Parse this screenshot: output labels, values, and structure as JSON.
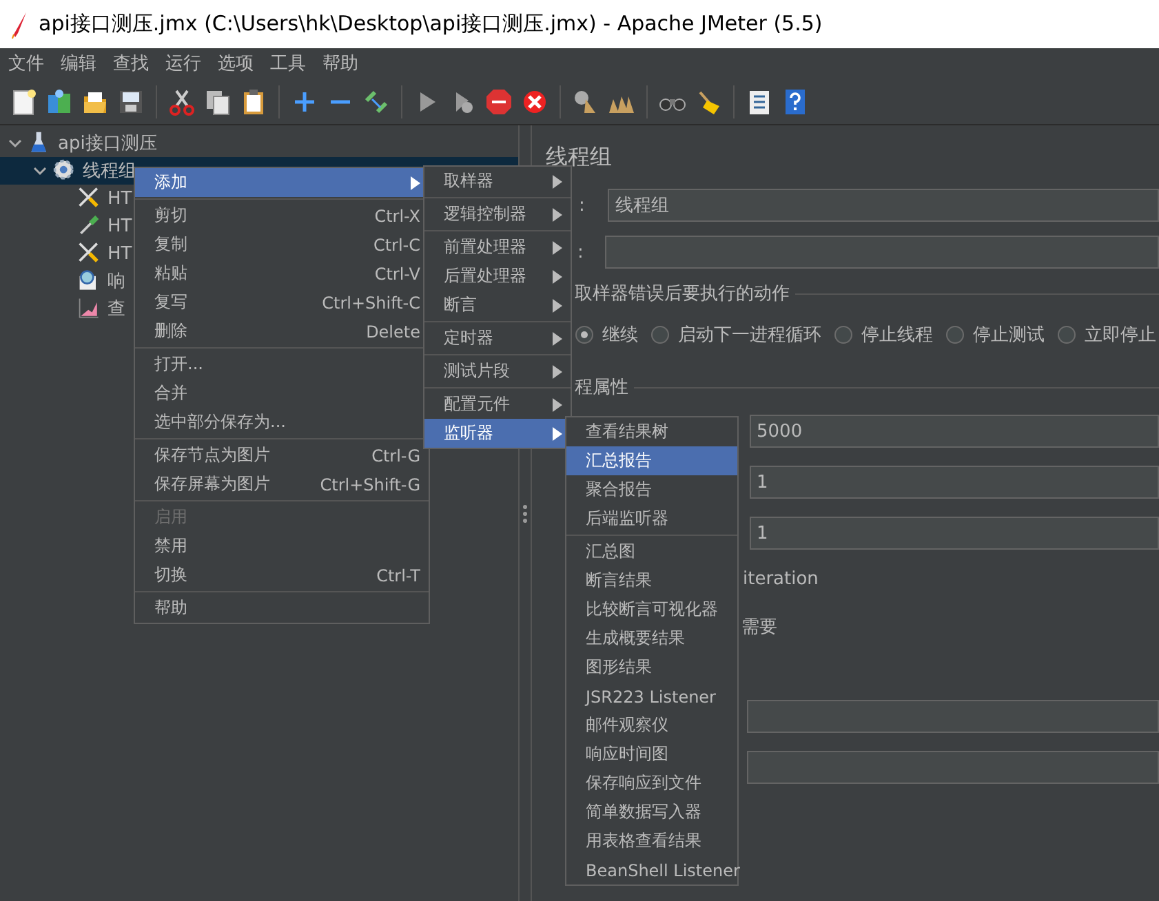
{
  "window": {
    "title": "api接口测压.jmx (C:\\Users\\hk\\Desktop\\api接口测压.jmx) - Apache JMeter (5.5)"
  },
  "menu_bar": [
    "文件",
    "编辑",
    "查找",
    "运行",
    "选项",
    "工具",
    "帮助"
  ],
  "tree": [
    {
      "label": "api接口测压",
      "expanded": true,
      "selected": false,
      "children": [
        {
          "label": "线程组",
          "expanded": true,
          "selected": true,
          "children": [
            {
              "label": "HT",
              "selected": false
            },
            {
              "label": "HT",
              "selected": false
            },
            {
              "label": "HT",
              "selected": false
            },
            {
              "label": "响",
              "selected": false
            },
            {
              "label": "查",
              "selected": false
            }
          ]
        }
      ]
    }
  ],
  "panel": {
    "title": "线程组",
    "name_label": ":",
    "name_value": "线程组",
    "comment_label": ":",
    "error_action": {
      "title": "取样器错误后要执行的动作",
      "options": [
        {
          "label": "继续",
          "selected": true
        },
        {
          "label": "启动下一进程循环",
          "selected": false
        },
        {
          "label": "停止线程",
          "selected": false
        },
        {
          "label": "停止测试",
          "selected": false
        },
        {
          "label": "立即停止",
          "selected": false
        }
      ]
    },
    "properties": {
      "title": "程属性",
      "fields": [
        "5000",
        "1",
        "1"
      ],
      "iteration_text": "iteration",
      "needs_text": "需要"
    }
  },
  "context_menu": {
    "groups": [
      [
        {
          "label": "添加",
          "submenu": true,
          "selected": true,
          "disabled": false
        }
      ],
      [
        {
          "label": "剪切",
          "shortcut": "Ctrl-X",
          "submenu": false,
          "selected": false,
          "disabled": false
        },
        {
          "label": "复制",
          "shortcut": "Ctrl-C",
          "submenu": false,
          "selected": false,
          "disabled": false
        },
        {
          "label": "粘贴",
          "shortcut": "Ctrl-V",
          "submenu": false,
          "selected": false,
          "disabled": false
        },
        {
          "label": "复写",
          "shortcut": "Ctrl+Shift-C",
          "submenu": false,
          "selected": false,
          "disabled": false
        },
        {
          "label": "删除",
          "shortcut": "Delete",
          "submenu": false,
          "selected": false,
          "disabled": false
        }
      ],
      [
        {
          "label": "打开...",
          "submenu": false,
          "selected": false,
          "disabled": false
        },
        {
          "label": "合并",
          "submenu": false,
          "selected": false,
          "disabled": false
        },
        {
          "label": "选中部分保存为...",
          "submenu": false,
          "selected": false,
          "disabled": false
        }
      ],
      [
        {
          "label": "保存节点为图片",
          "shortcut": "Ctrl-G",
          "submenu": false,
          "selected": false,
          "disabled": false
        },
        {
          "label": "保存屏幕为图片",
          "shortcut": "Ctrl+Shift-G",
          "submenu": false,
          "selected": false,
          "disabled": false
        }
      ],
      [
        {
          "label": "启用",
          "submenu": false,
          "selected": false,
          "disabled": true
        },
        {
          "label": "禁用",
          "submenu": false,
          "selected": false,
          "disabled": false
        },
        {
          "label": "切换",
          "shortcut": "Ctrl-T",
          "submenu": false,
          "selected": false,
          "disabled": false
        }
      ],
      [
        {
          "label": "帮助",
          "submenu": false,
          "selected": false,
          "disabled": false
        }
      ]
    ]
  },
  "add_submenu": {
    "groups": [
      [
        {
          "label": "取样器",
          "selected": false
        }
      ],
      [
        {
          "label": "逻辑控制器",
          "selected": false
        }
      ],
      [
        {
          "label": "前置处理器",
          "selected": false
        },
        {
          "label": "后置处理器",
          "selected": false
        },
        {
          "label": "断言",
          "selected": false
        }
      ],
      [
        {
          "label": "定时器",
          "selected": false
        }
      ],
      [
        {
          "label": "测试片段",
          "selected": false
        }
      ],
      [
        {
          "label": "配置元件",
          "selected": false
        },
        {
          "label": "监听器",
          "selected": true
        }
      ]
    ]
  },
  "listener_submenu": {
    "groups": [
      [
        {
          "label": "查看结果树",
          "selected": false
        },
        {
          "label": "汇总报告",
          "selected": true
        },
        {
          "label": "聚合报告",
          "selected": false
        },
        {
          "label": "后端监听器",
          "selected": false
        }
      ],
      [
        {
          "label": "汇总图",
          "selected": false
        },
        {
          "label": "断言结果",
          "selected": false
        },
        {
          "label": "比较断言可视化器",
          "selected": false
        },
        {
          "label": "生成概要结果",
          "selected": false
        },
        {
          "label": "图形结果",
          "selected": false
        },
        {
          "label": "JSR223 Listener",
          "selected": false
        },
        {
          "label": "邮件观察仪",
          "selected": false
        },
        {
          "label": "响应时间图",
          "selected": false
        },
        {
          "label": "保存响应到文件",
          "selected": false
        },
        {
          "label": "简单数据写入器",
          "selected": false
        },
        {
          "label": "用表格查看结果",
          "selected": false
        },
        {
          "label": "BeanShell Listener",
          "selected": false
        }
      ]
    ]
  }
}
